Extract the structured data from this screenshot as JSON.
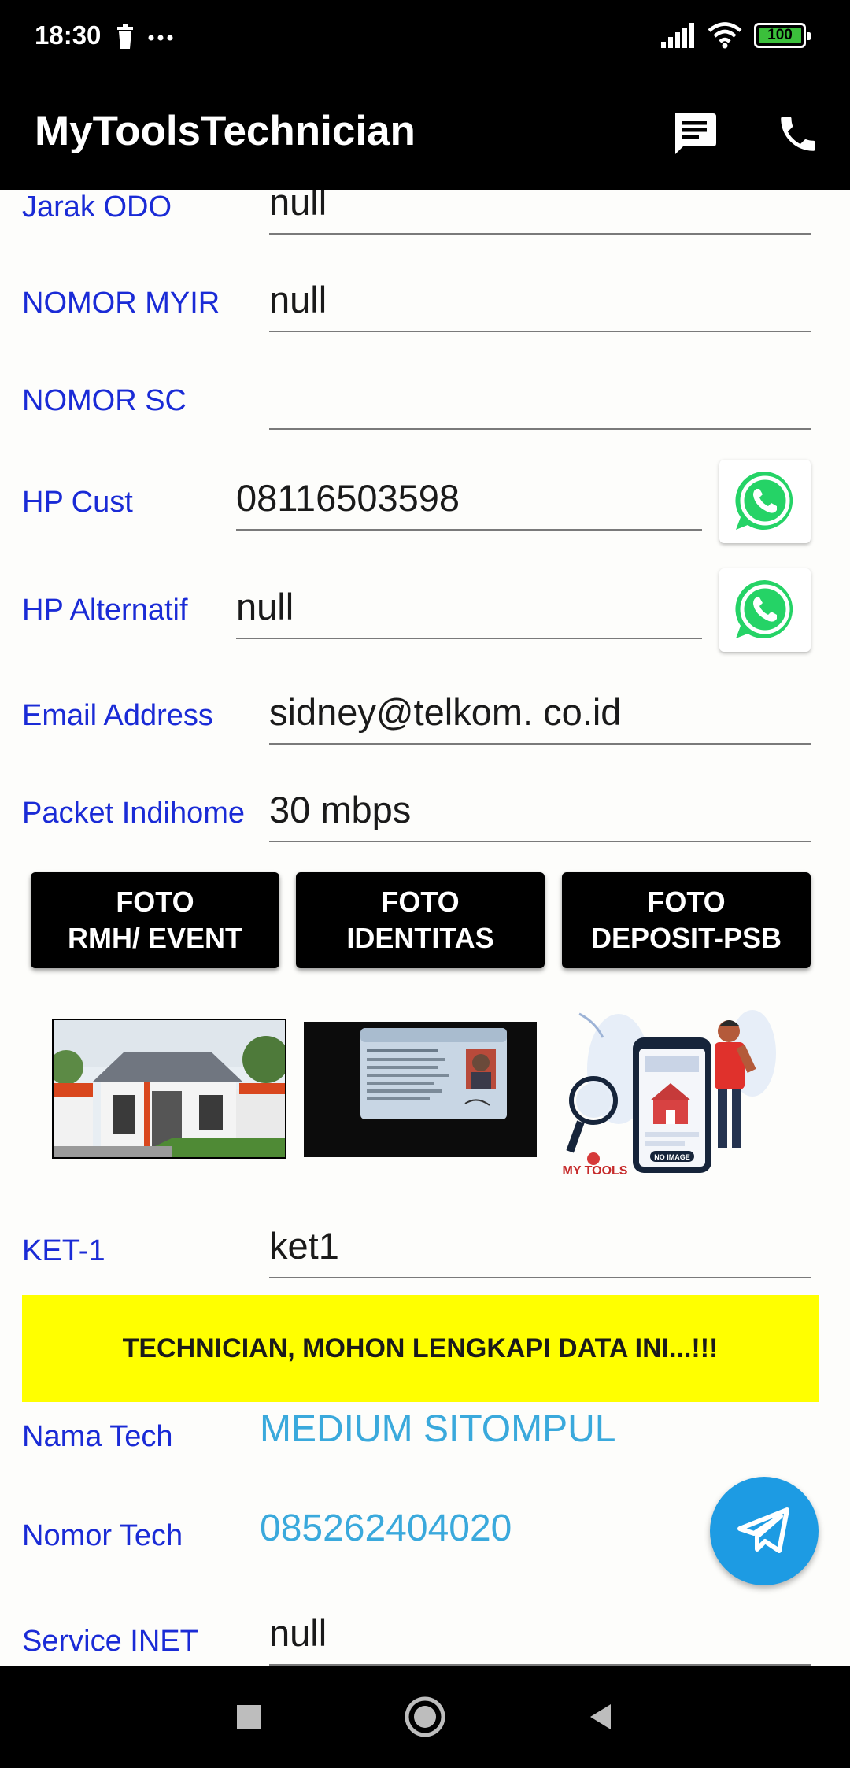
{
  "status_bar": {
    "time": "18:30",
    "battery_level": "100",
    "icons": [
      "trash-icon",
      "more-dots-icon",
      "signal-icon",
      "wifi-icon",
      "battery-icon"
    ]
  },
  "app_bar": {
    "title": "MyToolsTechnician",
    "actions": [
      "message-icon",
      "phone-icon"
    ]
  },
  "form": {
    "jarak_odo": {
      "label": "Jarak ODO",
      "value": "null"
    },
    "nomor_myir": {
      "label": "NOMOR MYIR",
      "value": "null"
    },
    "nomor_sc": {
      "label": "NOMOR SC",
      "value": ""
    },
    "hp_cust": {
      "label": "HP Cust",
      "value": "08116503598"
    },
    "hp_alternatif": {
      "label": "HP Alternatif",
      "value": "null"
    },
    "email": {
      "label": "Email Address",
      "value": "sidney@telkom. co.id"
    },
    "packet": {
      "label": "Packet Indihome",
      "value": "30 mbps"
    }
  },
  "photo_buttons": [
    {
      "label": "FOTO RMH/ EVENT"
    },
    {
      "label": "FOTO IDENTITAS"
    },
    {
      "label": "FOTO DEPOSIT-PSB"
    }
  ],
  "thumbnails": {
    "placeholder_caption": "MY TOOLS",
    "placeholder_badge": "NO IMAGE"
  },
  "ket1": {
    "label": "KET-1",
    "value": "ket1"
  },
  "banner": {
    "text": "TECHNICIAN, MOHON LENGKAPI DATA INI...!!!"
  },
  "tech": {
    "name_label": "Nama Tech",
    "name_value": "MEDIUM SITOMPUL",
    "number_label": "Nomor Tech",
    "number_value": "085262404020"
  },
  "service_inet": {
    "label": "Service INET",
    "value": "null"
  },
  "colors": {
    "label_blue": "#1a2bd6",
    "tech_value_blue": "#3aa9dc",
    "banner_yellow": "#ffff00",
    "whatsapp_green": "#25d366",
    "telegram_blue": "#1d9be3"
  }
}
